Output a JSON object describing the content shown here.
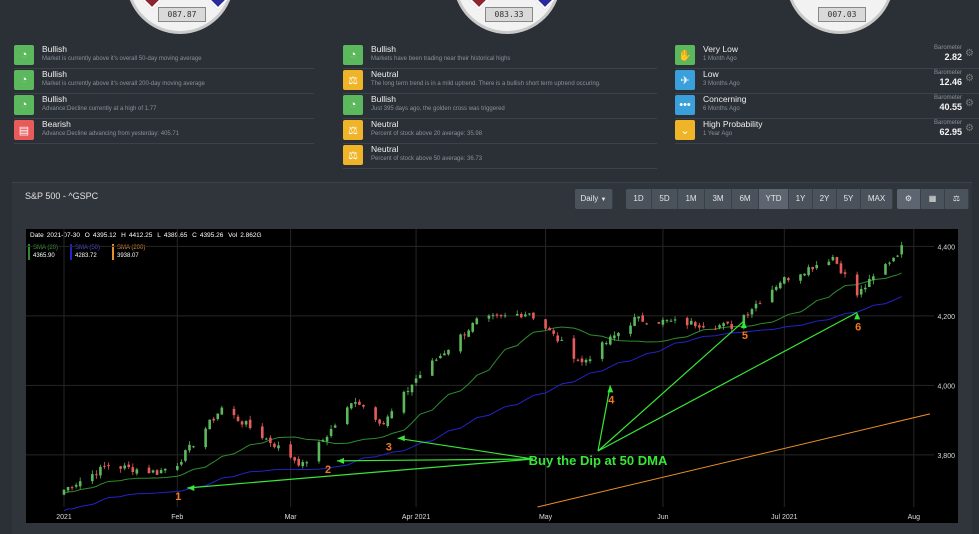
{
  "gauges": [
    {
      "value": "087.87"
    },
    {
      "value": "083.33"
    },
    {
      "value": "007.03"
    }
  ],
  "signals_col1": [
    {
      "status": "Bullish",
      "desc": "Market is currently above it's overall 50-day moving average",
      "color": "green",
      "icon": "gauge-icon"
    },
    {
      "status": "Bullish",
      "desc": "Market is currently above it's overall 200-day moving average",
      "color": "green",
      "icon": "gauge-icon"
    },
    {
      "status": "Bullish",
      "desc": "Advance:Decline currently at a high of 1.77",
      "color": "green",
      "icon": "gauge-icon"
    },
    {
      "status": "Bearish",
      "desc": "Advance:Decline advancing from yesterday: 405.71",
      "color": "red",
      "icon": "message-icon"
    }
  ],
  "signals_col2": [
    {
      "status": "Bullish",
      "desc": "Markets have been trading near their historical highs",
      "color": "green",
      "icon": "gauge-icon"
    },
    {
      "status": "Neutral",
      "desc": "The long term trend is in a mild uptrend. There is a bullish short term uptrend occuring.",
      "color": "yellow",
      "icon": "balance-icon"
    },
    {
      "status": "Bullish",
      "desc": "Just 395 days ago, the golden cross was triggered",
      "color": "green",
      "icon": "gauge-icon"
    },
    {
      "status": "Neutral",
      "desc": "Percent of stock above 20 average: 35.98",
      "color": "yellow",
      "icon": "balance-icon"
    },
    {
      "status": "Neutral",
      "desc": "Percent of stock above 50 average: 36.73",
      "color": "yellow",
      "icon": "balance-icon"
    }
  ],
  "signals_col3": [
    {
      "status": "Very Low",
      "desc": "1 Month Ago",
      "barometer_label": "Barometer",
      "barometer": "2.82",
      "color": "green",
      "icon": "hand-icon"
    },
    {
      "status": "Low",
      "desc": "3 Months Ago",
      "barometer_label": "Barometer",
      "barometer": "12.46",
      "color": "blue",
      "icon": "plane-icon"
    },
    {
      "status": "Concerning",
      "desc": "6 Months Ago",
      "barometer_label": "Barometer",
      "barometer": "40.55",
      "color": "blue",
      "icon": "dots-icon"
    },
    {
      "status": "High Probability",
      "desc": "1 Year Ago",
      "barometer_label": "Barometer",
      "barometer": "62.95",
      "color": "yellow",
      "icon": "chevron-down-icon"
    }
  ],
  "chart_panel": {
    "title": "S&P 500 - ^GSPC",
    "interval_label": "Daily",
    "ranges": [
      "1D",
      "5D",
      "1M",
      "3M",
      "6M",
      "YTD",
      "1Y",
      "2Y",
      "5Y",
      "MAX"
    ]
  },
  "hud": {
    "date_label": "Date",
    "date": "2021-07-30",
    "o_label": "O",
    "o": "4395.12",
    "h_label": "H",
    "h": "4412.25",
    "l_label": "L",
    "l": "4389.65",
    "c_label": "C",
    "c": "4395.26",
    "vol_label": "Vol",
    "vol": "2.862G"
  },
  "legend": [
    {
      "name": "SMA (20)",
      "value": "4365.90",
      "color": "#2e8b2e"
    },
    {
      "name": "SMA (50)",
      "value": "4283.72",
      "color": "#2323c8"
    },
    {
      "name": "SMA (200)",
      "value": "3938.07",
      "color": "#e8902a"
    }
  ],
  "annotation": {
    "text": "Buy the Dip at 50 DMA",
    "points": [
      "1",
      "2",
      "3",
      "4",
      "5",
      "6"
    ]
  },
  "chart_data": {
    "type": "candlestick",
    "title": "S&P 500 - ^GSPC",
    "x_ticks": [
      "2021",
      "Feb",
      "Mar",
      "Apr 2021",
      "May",
      "Jun",
      "Jul 2021",
      "Aug"
    ],
    "y_ticks": [
      3800,
      4000,
      4200,
      4400
    ],
    "ylim": [
      3650,
      4450
    ],
    "close_anchors": [
      {
        "date": "2021-01-04",
        "close": 3700
      },
      {
        "date": "2021-01-15",
        "close": 3770
      },
      {
        "date": "2021-01-27",
        "close": 3750
      },
      {
        "date": "2021-02-01",
        "close": 3775
      },
      {
        "date": "2021-02-12",
        "close": 3935
      },
      {
        "date": "2021-02-25",
        "close": 3830
      },
      {
        "date": "2021-03-04",
        "close": 3770
      },
      {
        "date": "2021-03-17",
        "close": 3960
      },
      {
        "date": "2021-03-24",
        "close": 3890
      },
      {
        "date": "2021-04-01",
        "close": 4020
      },
      {
        "date": "2021-04-16",
        "close": 4185
      },
      {
        "date": "2021-04-29",
        "close": 4210
      },
      {
        "date": "2021-05-12",
        "close": 4065
      },
      {
        "date": "2021-05-25",
        "close": 4190
      },
      {
        "date": "2021-06-18",
        "close": 4170
      },
      {
        "date": "2021-06-30",
        "close": 4300
      },
      {
        "date": "2021-07-13",
        "close": 4370
      },
      {
        "date": "2021-07-19",
        "close": 4260
      },
      {
        "date": "2021-07-30",
        "close": 4395
      }
    ],
    "series": [
      {
        "name": "SMA (20)",
        "last": 4365.9
      },
      {
        "name": "SMA (50)",
        "last": 4283.72
      },
      {
        "name": "SMA (200)",
        "last": 3938.07
      }
    ],
    "colors": {
      "up": "#5cb85c",
      "down": "#e85b5b",
      "sma20": "#2e8b2e",
      "sma50": "#2323c8",
      "sma200": "#e8902a",
      "annotation": "#37e637",
      "marker": "#f07820",
      "grid": "#262626"
    }
  }
}
